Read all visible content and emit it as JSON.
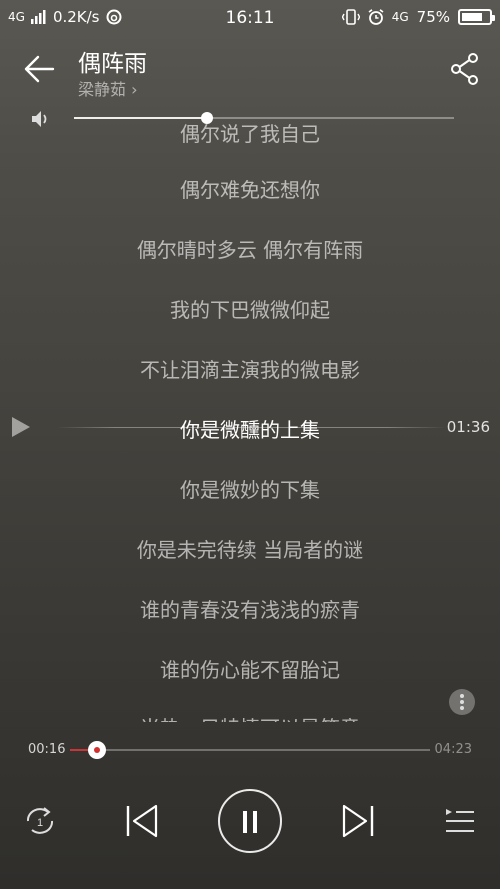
{
  "status_bar": {
    "network_type": "4G",
    "data_speed": "0.2K/s",
    "time": "16:11",
    "network_type_right": "4G",
    "battery": "75%",
    "battery_level": 0.75
  },
  "header": {
    "song_title": "偶阵雨",
    "artist": "梁静茹 ›"
  },
  "volume": {
    "level": 0.35
  },
  "lyrics": {
    "lines": [
      "偶尔说了我自己",
      "偶尔难免还想你",
      "偶尔晴时多云 偶尔有阵雨",
      "我的下巴微微仰起",
      "不让泪滴主演我的微电影",
      "你是微醺的上集",
      "你是微妙的下集",
      "你是未完待续 当局者的谜",
      "谁的青春没有浅浅的瘀青",
      "谁的伤心能不留胎记",
      "当热一只特情可以是笑意"
    ],
    "current_index": 5,
    "seek_time": "01:36"
  },
  "progress": {
    "current": "00:16",
    "total": "04:23",
    "fraction": 0.075
  },
  "colors": {
    "accent": "#d32f2f"
  }
}
